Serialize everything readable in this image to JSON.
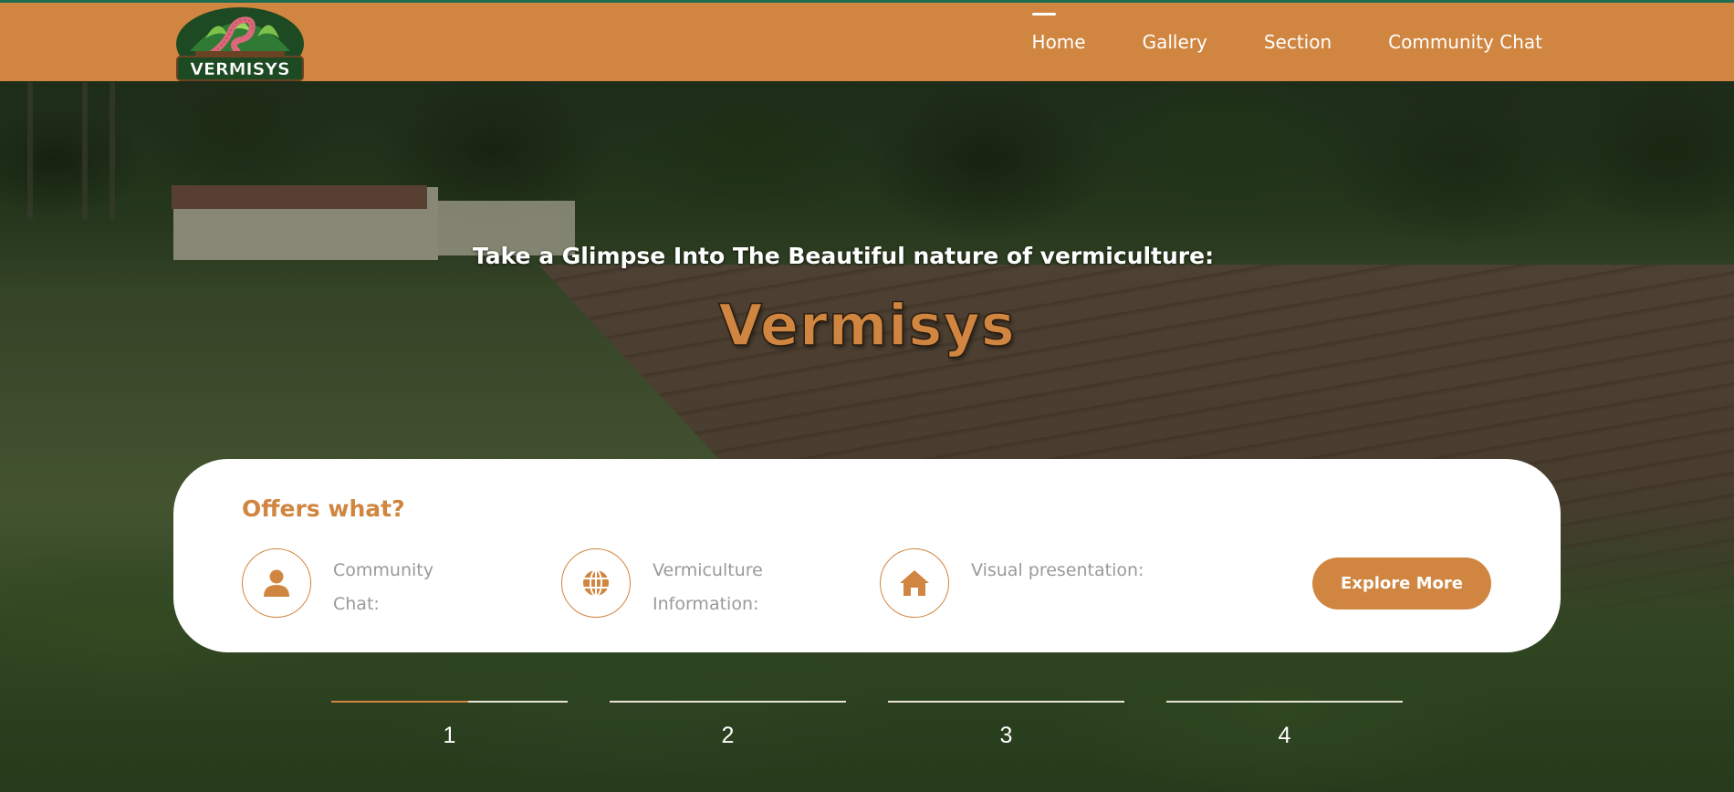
{
  "nav": {
    "logo_text": "VERMISYS",
    "links": [
      {
        "label": "Home",
        "active": true
      },
      {
        "label": "Gallery",
        "active": false
      },
      {
        "label": "Section",
        "active": false
      },
      {
        "label": "Community Chat",
        "active": false
      }
    ]
  },
  "hero": {
    "tagline": "Take a Glimpse Into The Beautiful nature of vermiculture:",
    "title": "Vermisys"
  },
  "offers": {
    "heading": "Offers what?",
    "items": [
      {
        "icon": "user-icon",
        "label": "Community Chat:"
      },
      {
        "icon": "globe-icon",
        "label": "Vermiculture Information:"
      },
      {
        "icon": "home-icon",
        "label": "Visual presentation:"
      }
    ],
    "button_label": "Explore More"
  },
  "slider": {
    "indicators": [
      "1",
      "2",
      "3",
      "4"
    ],
    "active_index": 0,
    "active_progress": 0.58
  },
  "colors": {
    "accent": "#d08640",
    "nav_bg": "#d08640",
    "top_line": "#1f6b4f",
    "label_gray": "#9a9a9a"
  }
}
